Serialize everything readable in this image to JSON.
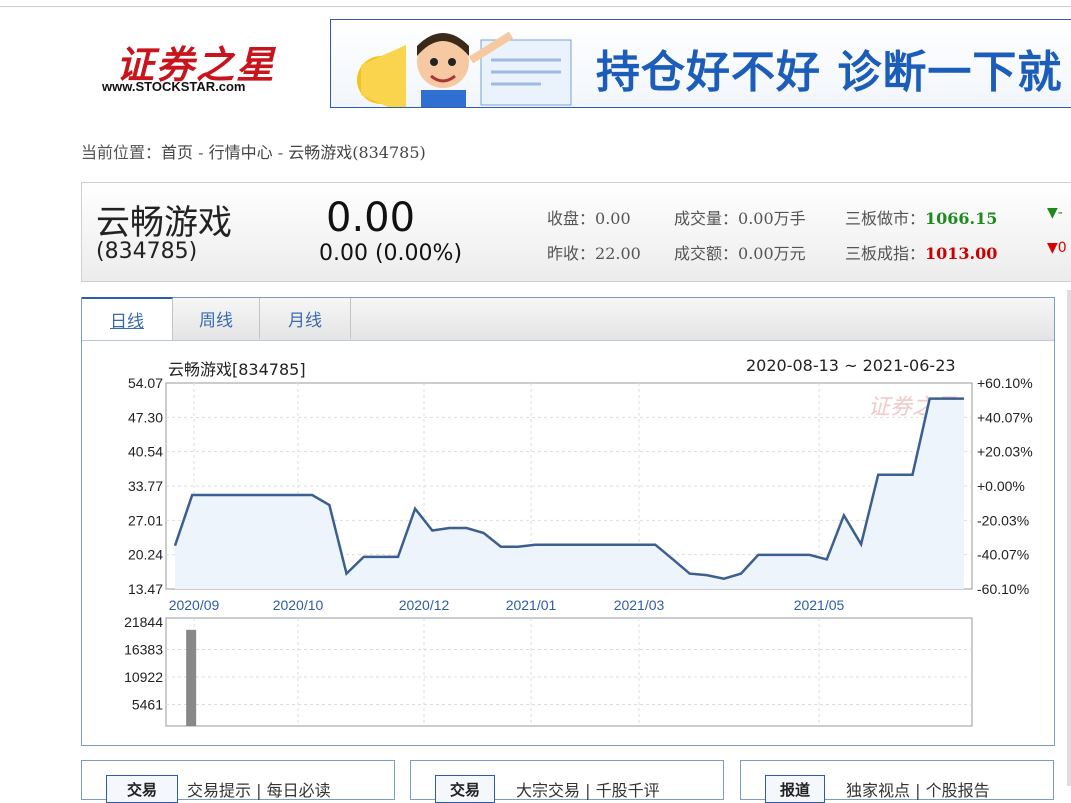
{
  "header": {
    "logo_cn": "证券之星",
    "logo_url": "www.STOCKSTAR.com",
    "banner_text": "持仓好不好 诊断一下就"
  },
  "breadcrumb": {
    "prefix": "当前位置：",
    "items": [
      "首页",
      "行情中心",
      "云畅游戏(834785)"
    ],
    "sep": " - "
  },
  "quote": {
    "name": "云畅游戏",
    "code": "(834785)",
    "price": "0.00",
    "change": "0.00  (0.00%)",
    "close_label": "收盘：",
    "close": "0.00",
    "prev_label": "昨收：",
    "prev": "22.00",
    "vol_label": "成交量：",
    "vol": "0.00万手",
    "amt_label": "成交额：",
    "amt": "0.00万元",
    "mm_label": "三板做市：",
    "mm": "1066.15",
    "idx_label": "三板成指：",
    "idx": "1013.00",
    "mm_arrow": "▼-",
    "idx_arrow": "▼0"
  },
  "tabs": [
    "日线",
    "周线",
    "月线"
  ],
  "chart_data": {
    "type": "line",
    "title": "云畅游戏[834785]",
    "range": "2020-08-13 ~ 2021-06-23",
    "ylim": [
      13.47,
      54.07
    ],
    "y_ticks_left": [
      "54.07",
      "47.30",
      "40.54",
      "33.77",
      "27.01",
      "20.24",
      "13.47"
    ],
    "y_ticks_right": [
      "+60.10%",
      "+40.07%",
      "+20.03%",
      "+0.00%",
      "-20.03%",
      "-40.07%",
      "-60.10%"
    ],
    "x_tick_labels": [
      "2020/09",
      "2020/10",
      "2020/12",
      "2021/01",
      "2021/03",
      "2021/05"
    ],
    "x": [
      0,
      1,
      2,
      3,
      4,
      5,
      6,
      7,
      8,
      9,
      10,
      11,
      12,
      13,
      14,
      15,
      16,
      17,
      18,
      19,
      20,
      21,
      22,
      23,
      24,
      25,
      26,
      27,
      28,
      29,
      30,
      31,
      32,
      33,
      34,
      35,
      36,
      37,
      38,
      39,
      40,
      41,
      42,
      43,
      44,
      45,
      46
    ],
    "values": [
      22.0,
      32.0,
      32.0,
      32.0,
      32.0,
      32.0,
      32.0,
      32.0,
      32.0,
      30.0,
      16.5,
      19.8,
      19.8,
      19.8,
      29.3,
      25.0,
      25.5,
      25.5,
      24.5,
      21.8,
      21.8,
      22.2,
      22.2,
      22.2,
      22.2,
      22.2,
      22.2,
      22.2,
      22.2,
      19.4,
      16.5,
      16.2,
      15.5,
      16.5,
      20.2,
      20.2,
      20.2,
      20.2,
      19.3,
      28.0,
      22.3,
      36.0,
      36.0,
      36.0,
      51.0,
      51.0,
      51.0
    ],
    "volume": {
      "y_ticks": [
        "21844",
        "16383",
        "10922",
        "5461"
      ],
      "ylim": [
        0,
        21844
      ],
      "bars": [
        {
          "x": 1,
          "value": 20200
        }
      ]
    },
    "watermark": "证券之星",
    "line_color": "#3b5f8f",
    "fill_color": "#eef4fb"
  },
  "bottom": [
    {
      "tag": "交易",
      "text": "交易提示 | 每日必读"
    },
    {
      "tag": "交易",
      "text": "大宗交易 | 千股千评"
    },
    {
      "tag": "报道",
      "text": "独家视点 | 个股报告"
    }
  ]
}
